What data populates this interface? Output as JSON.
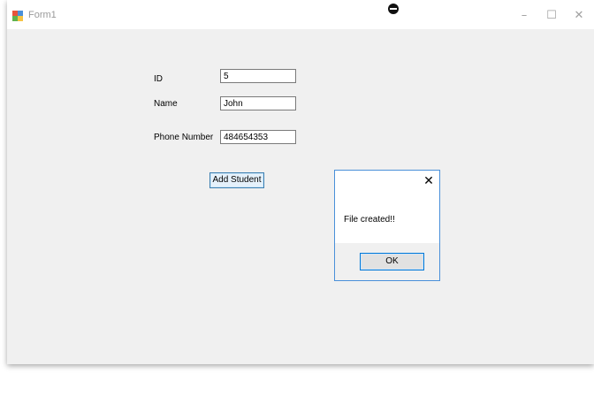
{
  "window": {
    "title": "Form1",
    "minimize_glyph": "–",
    "maximize_glyph": "☐",
    "close_glyph": "✕",
    "icon": "form-icon"
  },
  "form": {
    "id_label": "ID",
    "id_value": "5",
    "name_label": "Name",
    "name_value": "John",
    "phone_label": "Phone Number",
    "phone_value": "484654353",
    "add_button": "Add Student"
  },
  "dialog": {
    "close_glyph": "✕",
    "message": "File created!!",
    "ok_button": "OK"
  },
  "colors": {
    "accent": "#0078d7",
    "window_bg": "#f0f0f0"
  }
}
